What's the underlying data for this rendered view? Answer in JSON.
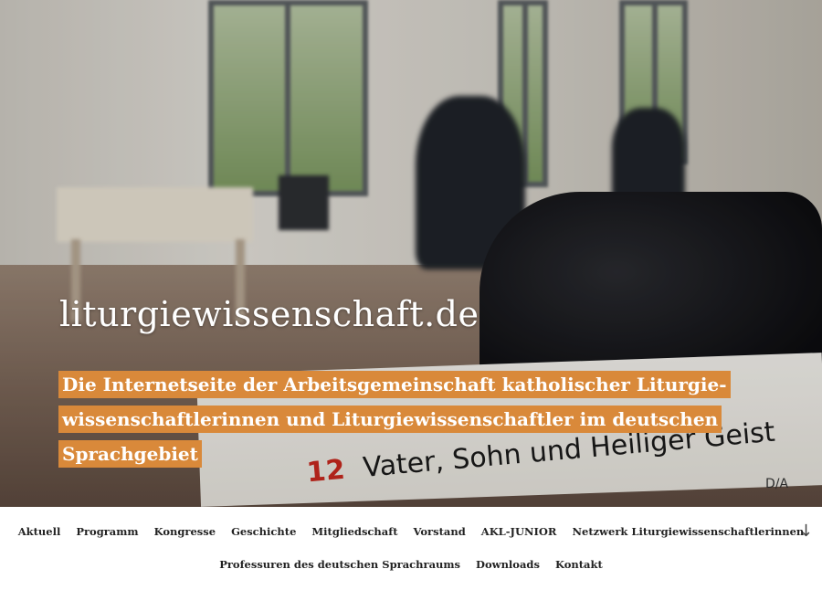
{
  "header": {
    "site_title": "liturgiewissenschaft.de",
    "tagline": "Die Internetseite der Arbeitsgemeinschaft katholischer Liturgie-wissenschaftlerinnen und Liturgiewissenschaftler im deutschen Sprachgebiet"
  },
  "hero_image": {
    "book_number": "12",
    "book_text": "Vater, Sohn und Heiliger Geist",
    "book_corner": "D/A"
  },
  "nav": {
    "row1": [
      "Aktuell",
      "Programm",
      "Kongresse",
      "Geschichte",
      "Mitgliedschaft",
      "Vorstand",
      "AKL-JUNIOR",
      "Netzwerk Liturgiewissenschaftlerinnen"
    ],
    "row2": [
      "Professuren des deutschen Sprachraums",
      "Downloads",
      "Kontakt"
    ],
    "scroll_icon": "arrow-down-icon"
  }
}
